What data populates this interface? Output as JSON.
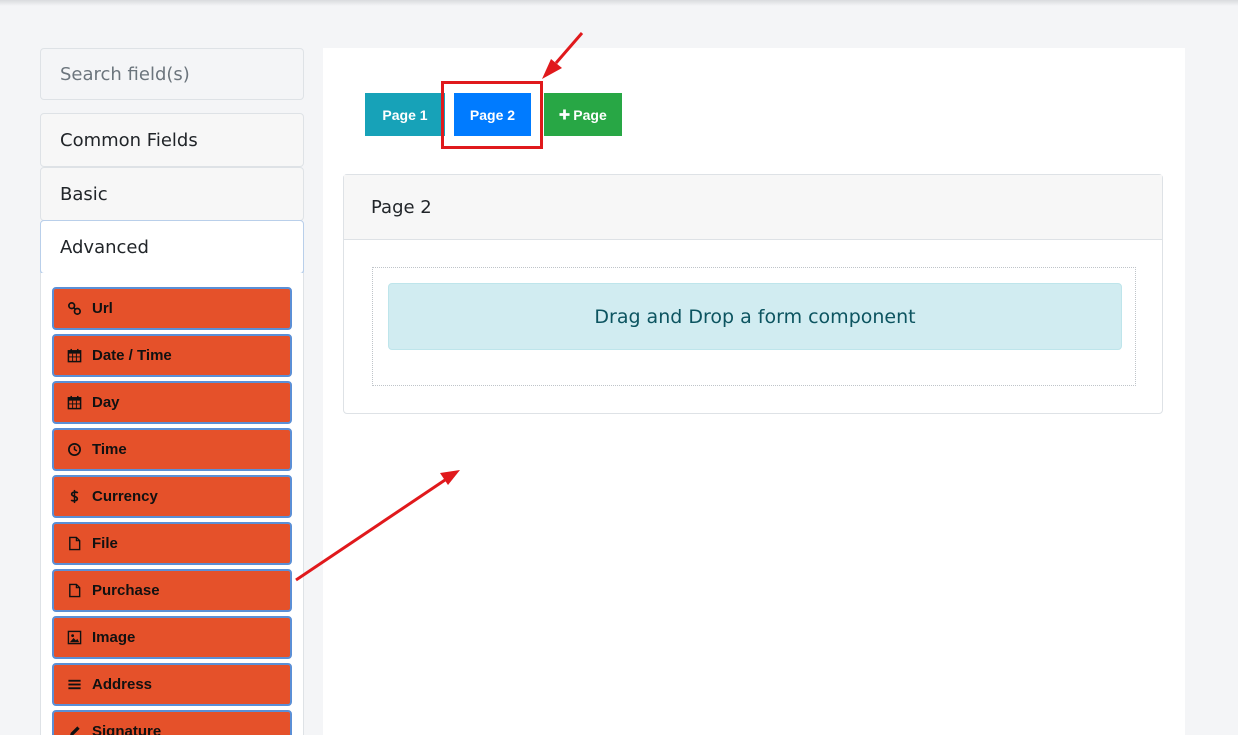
{
  "sidebar": {
    "search_placeholder": "Search field(s)",
    "groups": [
      {
        "label": "Common Fields"
      },
      {
        "label": "Basic"
      },
      {
        "label": "Advanced"
      }
    ],
    "advanced_fields": [
      {
        "label": "Url",
        "icon": "link-icon"
      },
      {
        "label": "Date / Time",
        "icon": "calendar-icon"
      },
      {
        "label": "Day",
        "icon": "calendar-icon"
      },
      {
        "label": "Time",
        "icon": "clock-icon"
      },
      {
        "label": "Currency",
        "icon": "dollar-icon"
      },
      {
        "label": "File",
        "icon": "file-icon"
      },
      {
        "label": "Purchase",
        "icon": "file-icon"
      },
      {
        "label": "Image",
        "icon": "image-icon"
      },
      {
        "label": "Address",
        "icon": "bars-icon"
      },
      {
        "label": "Signature",
        "icon": "pen-icon"
      }
    ]
  },
  "pages": {
    "tabs": [
      {
        "label": "Page 1",
        "color": "#17a2b8"
      },
      {
        "label": "Page 2",
        "color": "#007bff",
        "active": true
      }
    ],
    "add_label": "Page",
    "add_color": "#28a745"
  },
  "card": {
    "title": "Page 2",
    "drop_message": "Drag and Drop a form component"
  },
  "colors": {
    "field_button": "#e5512a",
    "annotation": "#e0191c"
  }
}
